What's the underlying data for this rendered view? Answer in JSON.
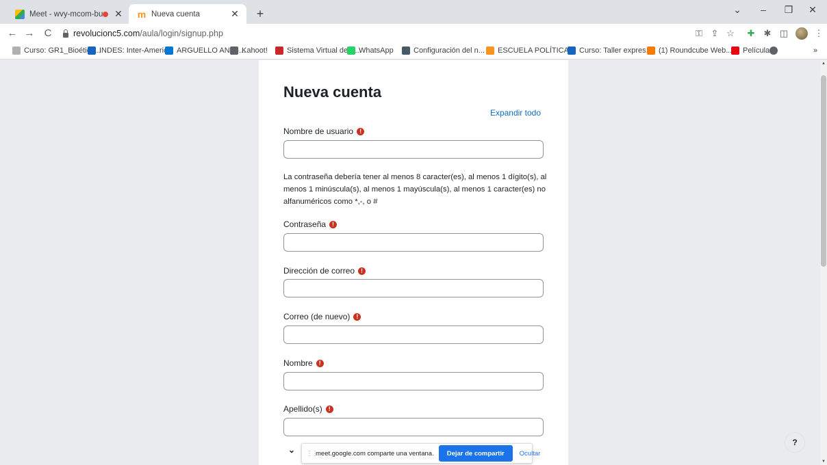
{
  "tabs": [
    {
      "label": "Meet - wvy-mcom-but",
      "recording": true
    },
    {
      "label": "Nueva cuenta"
    }
  ],
  "window_controls": {
    "collapse": "⌄",
    "minimize": "–",
    "restore": "❐",
    "close": "✕"
  },
  "toolbar": {
    "back": "←",
    "forward": "→",
    "reload": "C",
    "url_host": "revolucionc5.com",
    "url_path": "/aula/login/signup.php"
  },
  "bookmarks": [
    {
      "label": "Curso: GR1_Bioética...",
      "color": "#b0b0b0"
    },
    {
      "label": "INDES: Inter-Americ...",
      "color": "#1565c0"
    },
    {
      "label": "ARGUELLO ANA -...",
      "color": "#0078d4"
    },
    {
      "label": "Kahoot!",
      "color": "#5f6368"
    },
    {
      "label": "Sistema Virtual de E...",
      "color": "#c62828"
    },
    {
      "label": "WhatsApp",
      "color": "#25d366"
    },
    {
      "label": "Configuración del n...",
      "color": "#455a64"
    },
    {
      "label": "ESCUELA POLÍTICA...",
      "color": "#f7931e"
    },
    {
      "label": "Curso: Taller expres...",
      "color": "#1565c0"
    },
    {
      "label": "(1) Roundcube Web...",
      "color": "#f57c00"
    },
    {
      "label": "Películas",
      "color": "#e50914"
    },
    {
      "label": "",
      "color": "#5f6368"
    }
  ],
  "bookmarks_more": "»",
  "form": {
    "title": "Nueva cuenta",
    "expand_all": "Expandir todo",
    "username_label": "Nombre de usuario",
    "password_hint": "La contraseña debería tener al menos 8 caracter(es), al menos 1 dígito(s), al menos 1 minúscula(s), al menos 1 mayúscula(s), al menos 1 caracter(es) no alfanuméricos como *,-, o #",
    "password_label": "Contraseña",
    "email_label": "Dirección de correo",
    "email2_label": "Correo (de nuevo)",
    "firstname_label": "Nombre",
    "lastname_label": "Apellido(s)",
    "required_icon": "!"
  },
  "sharebar": {
    "text": "meet.google.com comparte una ventana.",
    "stop_label": "Dejar de compartir",
    "hide_label": "Ocultar"
  },
  "help_label": "?",
  "colors": {
    "accent": "#1a73e8",
    "link": "#0f6cbf",
    "required": "#ca3120"
  }
}
